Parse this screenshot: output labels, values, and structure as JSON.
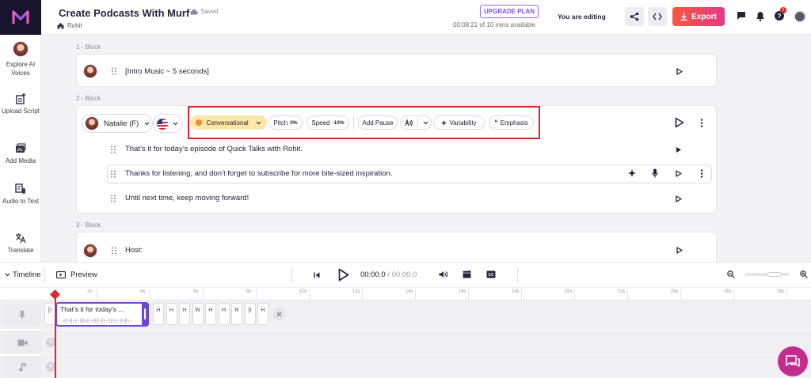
{
  "app": {
    "title": "Create Podcasts With Murf",
    "saved": "Saved",
    "breadcrumb": "Rohit"
  },
  "topbar": {
    "upgrade": "UPGRADE PLAN",
    "available": "00:08:21 of 10 mins available",
    "editing": "You are editing",
    "export": "Export",
    "help_badge": "1"
  },
  "sidebar": {
    "items": [
      {
        "label": "Explore AI Voices",
        "icon": "avatar"
      },
      {
        "label": "Upload Script",
        "icon": "upload-script-icon"
      },
      {
        "label": "Add Media",
        "icon": "media-icon"
      },
      {
        "label": "Audio to Text",
        "icon": "audio-to-text-icon"
      },
      {
        "label": "Translate",
        "icon": "translate-icon"
      }
    ]
  },
  "blocks": [
    {
      "label": "1 -  Block",
      "lines": [
        "[Intro Music ~ 5 seconds]"
      ]
    },
    {
      "label": "2 -  Block",
      "voice": "Natalie (F)",
      "lines": [
        "That’s it for today’s episode of Quick Talks with Rohit.",
        "Thanks for listening, and don’t forget to subscribe for more bite-sized inspiration.",
        "Until next time, keep moving forward!"
      ]
    },
    {
      "label": "3 -  Block",
      "lines": [
        "Host:"
      ]
    }
  ],
  "settings": {
    "style": "Conversational",
    "pitch_label": "Pitch",
    "pitch_value": "0%",
    "speed_label": "Speed",
    "speed_value": "-10%",
    "pause": "Add Pause",
    "variability": "Variability",
    "emphasis": "Emphasis"
  },
  "timeline": {
    "label": "Timeline",
    "preview": "Preview",
    "time_current": "00:00.0",
    "time_sep": " / ",
    "time_total": "00:00.0",
    "ticks": [
      "2s",
      "4s",
      "6s",
      "8s",
      "10s",
      "12s",
      "14s",
      "16s",
      "18s",
      "20s",
      "22s",
      "24s",
      "26s",
      "28s"
    ],
    "clip_text": "That’s it for today’s ...",
    "first_seg": "[I",
    "segments": [
      "H",
      "H",
      "H",
      "W",
      "H",
      "H",
      "R",
      "[I",
      "H"
    ]
  },
  "colors": {
    "accent": "#6d47d6",
    "export_start": "#f8563f",
    "export_end": "#e23a86",
    "highlight_box": "#e0252d",
    "style_pill": "#fde7a6"
  }
}
